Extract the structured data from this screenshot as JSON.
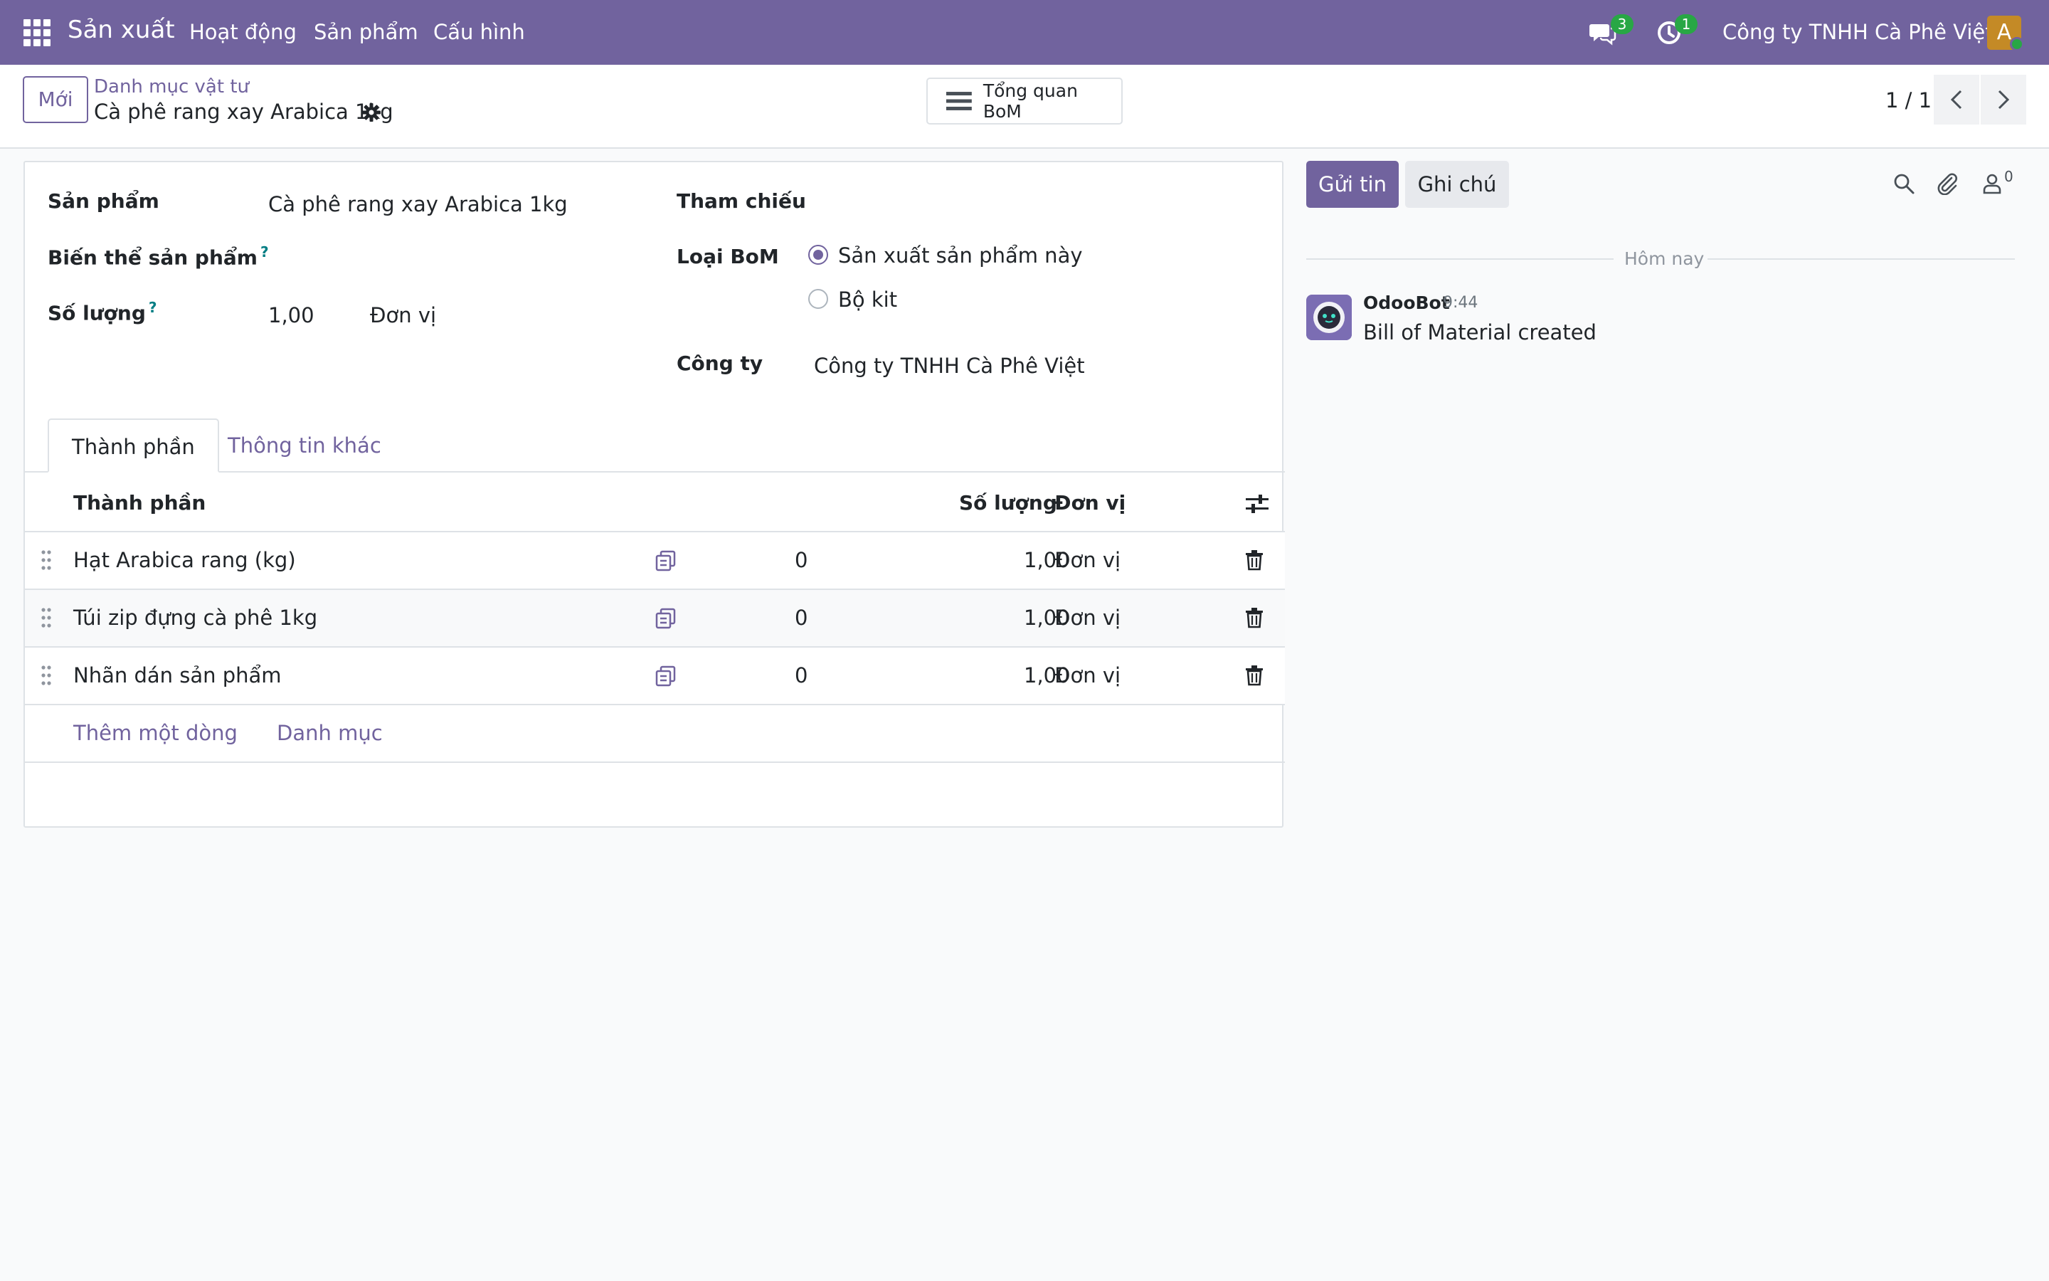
{
  "navbar": {
    "app_name": "Sản xuất",
    "menu": [
      "Hoạt động",
      "Sản phẩm",
      "Cấu hình"
    ],
    "messages_badge": "3",
    "activities_badge": "1",
    "company": "Công ty TNHH Cà Phê Việt",
    "avatar_letter": "A",
    "accent_color": "#71639e"
  },
  "control": {
    "new_label": "Mới",
    "breadcrumb": "Danh mục vật tư",
    "record_title": "Cà phê rang xay Arabica 1kg",
    "overview_label": "Tổng quan BoM",
    "pager": "1 / 1"
  },
  "form": {
    "product_label": "Sản phẩm",
    "product_value": "Cà phê rang xay Arabica 1kg",
    "variant_label": "Biến thể sản phẩm",
    "help": "?",
    "qty_label": "Số lượng",
    "qty_value": "1,00",
    "qty_uom": "Đơn vị",
    "reference_label": "Tham chiếu",
    "bom_type_label": "Loại BoM",
    "bom_type_options": [
      "Sản xuất sản phẩm này",
      "Bộ kit"
    ],
    "bom_type_selected": "Sản xuất sản phẩm này",
    "company_label": "Công ty",
    "company_value": "Công ty TNHH Cà Phê Việt"
  },
  "tabs": [
    "Thành phần",
    "Thông tin khác"
  ],
  "components": {
    "headers": {
      "component": "Thành phần",
      "qty": "Số lượng",
      "uom": "Đơn vị"
    },
    "rows": [
      {
        "name": "Hạt Arabica rang (kg)",
        "count": "0",
        "qty": "1,00",
        "uom": "Đơn vị"
      },
      {
        "name": "Túi zip đựng cà phê 1kg",
        "count": "0",
        "qty": "1,00",
        "uom": "Đơn vị"
      },
      {
        "name": "Nhãn dán sản phẩm",
        "count": "0",
        "qty": "1,00",
        "uom": "Đơn vị"
      }
    ],
    "add_line": "Thêm một dòng",
    "catalog": "Danh mục"
  },
  "chatter": {
    "send_label": "Gửi tin",
    "note_label": "Ghi chú",
    "followers": "0",
    "date_divider": "Hôm nay",
    "messages": [
      {
        "author": "OdooBot",
        "time": "9:44",
        "body": "Bill of Material created"
      }
    ]
  }
}
